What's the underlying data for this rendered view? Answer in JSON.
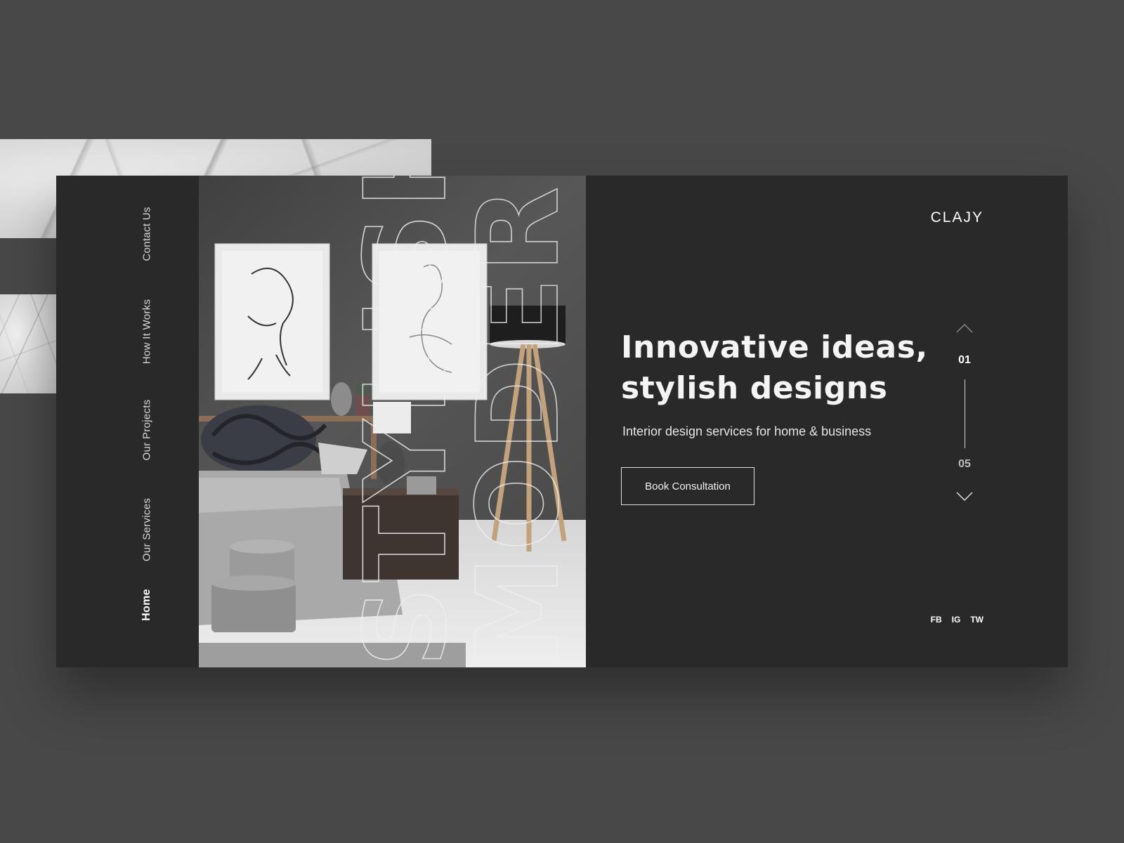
{
  "brand": {
    "logo": "CLAJY"
  },
  "nav": {
    "items": [
      "Home",
      "Our Services",
      "Our Projects",
      "How It Works",
      "Contact Us"
    ],
    "active": "Home"
  },
  "hero": {
    "outline_text_1": "STYLISH",
    "outline_text_2": "MODERN",
    "headline_line1": "Innovative ideas,",
    "headline_line2": "stylish designs",
    "subtitle": "Interior design services for home & business",
    "cta_label": "Book Consultation"
  },
  "slider": {
    "current": "01",
    "total": "05",
    "up_icon": "chevron-up-icon",
    "down_icon": "chevron-down-icon"
  },
  "socials": [
    "FB",
    "IG",
    "TW"
  ],
  "colors": {
    "page_bg": "#484848",
    "card_bg": "#292929",
    "text": "#ffffff"
  }
}
